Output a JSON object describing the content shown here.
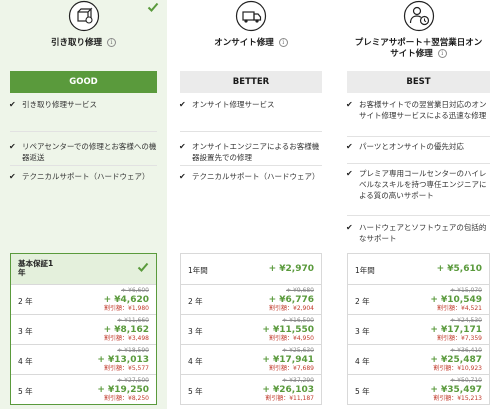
{
  "colors": {
    "accent": "#5a9a3c",
    "discount": "#c0392b",
    "strike": "#8a8a8a"
  },
  "plans": [
    {
      "icon": "pickup-repair-icon",
      "title_lines": [
        "引き取り修理"
      ],
      "info_label": "i",
      "tier": "GOOD",
      "selected": true,
      "features": [
        "引き取り修理サービス",
        "リペアセンターでの修理とお客様への機器返送",
        "テクニカルサポート（ハードウェア）"
      ],
      "prices": [
        {
          "year": "基本保証1年",
          "price": "",
          "strike": "",
          "discount": ""
        },
        {
          "year": "2 年",
          "strike": "+ ¥6,600",
          "price": "+ ¥4,620",
          "discount": "割引額：¥1,980"
        },
        {
          "year": "3 年",
          "strike": "+ ¥11,660",
          "price": "+ ¥8,162",
          "discount": "割引額：¥3,498"
        },
        {
          "year": "4 年",
          "strike": "+ ¥18,590",
          "price": "+ ¥13,013",
          "discount": "割引額：¥5,577"
        },
        {
          "year": "5 年",
          "strike": "+ ¥27,500",
          "price": "+ ¥19,250",
          "discount": "割引額：¥8,250"
        }
      ]
    },
    {
      "icon": "onsite-repair-truck-icon",
      "title_lines": [
        "オンサイト修理"
      ],
      "info_label": "i",
      "tier": "BETTER",
      "selected": false,
      "features": [
        "オンサイト修理サービス",
        "オンサイトエンジニアによるお客様機器設置先での修理",
        "テクニカルサポート（ハードウェア）"
      ],
      "prices": [
        {
          "year": "1年間",
          "price": "+ ¥2,970",
          "strike": "",
          "discount": ""
        },
        {
          "year": "2 年",
          "strike": "+ ¥9,680",
          "price": "+ ¥6,776",
          "discount": "割引額：¥2,904"
        },
        {
          "year": "3 年",
          "strike": "+ ¥16,500",
          "price": "+ ¥11,550",
          "discount": "割引額：¥4,950"
        },
        {
          "year": "4 年",
          "strike": "+ ¥25,630",
          "price": "+ ¥17,941",
          "discount": "割引額：¥7,689"
        },
        {
          "year": "5 年",
          "strike": "+ ¥37,290",
          "price": "+ ¥26,103",
          "discount": "割引額：¥11,187"
        }
      ]
    },
    {
      "icon": "premium-support-person-icon",
      "title_lines": [
        "プレミアサポート＋翌営業日オン",
        "サイト修理"
      ],
      "info_label": "i",
      "tier": "BEST",
      "selected": false,
      "features": [
        "お客様サイトでの翌営業日対応のオンサイト修理サービスによる迅速な修理",
        "パーツとオンサイトの優先対応",
        "プレミア専用コールセンターのハイレベルなスキルを持つ専任エンジニアによる質の高いサポート",
        "ハードウェアとソフトウェアの包括的なサポート"
      ],
      "prices": [
        {
          "year": "1年間",
          "price": "+ ¥5,610",
          "strike": "",
          "discount": ""
        },
        {
          "year": "2 年",
          "strike": "+ ¥15,070",
          "price": "+ ¥10,549",
          "discount": "割引額：¥4,521"
        },
        {
          "year": "3 年",
          "strike": "+ ¥24,530",
          "price": "+ ¥17,171",
          "discount": "割引額：¥7,359"
        },
        {
          "year": "4 年",
          "strike": "+ ¥36,410",
          "price": "+ ¥25,487",
          "discount": "割引額：¥10,923"
        },
        {
          "year": "5 年",
          "strike": "+ ¥50,710",
          "price": "+ ¥35,497",
          "discount": "割引額：¥15,213"
        }
      ]
    }
  ]
}
